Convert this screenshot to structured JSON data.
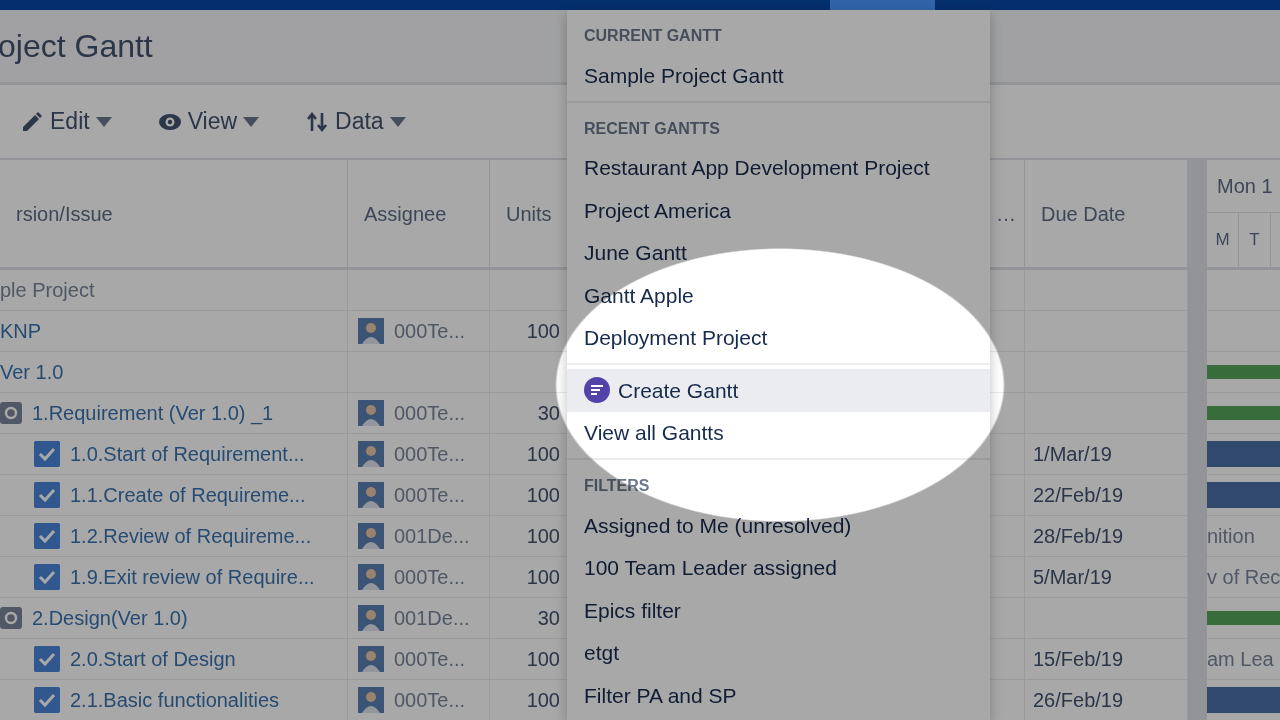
{
  "page_title": "oject Gantt",
  "toolbar": [
    {
      "label": "Edit"
    },
    {
      "label": "View"
    },
    {
      "label": "Data"
    }
  ],
  "table": {
    "columns": [
      "rsion/Issue",
      "Assignee",
      "Units",
      "…",
      "Due Date"
    ],
    "timeline": {
      "week": "Mon 1",
      "days": [
        "M",
        "T"
      ]
    },
    "rows": [
      {
        "kind": "project",
        "title": "ple Project",
        "units": "",
        "due": ""
      },
      {
        "kind": "version",
        "title": "KNP",
        "assignee": "000Te...",
        "units": "100",
        "due": ""
      },
      {
        "kind": "version",
        "title": "Ver 1.0",
        "units": "",
        "due": "",
        "bar": {
          "kind": "summary"
        }
      },
      {
        "kind": "group",
        "title": "1.Requirement (Ver 1.0) _1",
        "assignee": "000Te...",
        "units": "30",
        "due": "",
        "bar": {
          "kind": "summary"
        },
        "children": [
          {
            "kind": "task",
            "checked": true,
            "title": "1.0.Start of Requirement...",
            "assignee": "000Te...",
            "units": "100",
            "due": "1/Mar/19",
            "bar": {
              "kind": "task"
            }
          },
          {
            "kind": "task",
            "checked": true,
            "title": "1.1.Create of Requireme...",
            "assignee": "000Te...",
            "units": "100",
            "due": "22/Feb/19",
            "bar": {
              "kind": "task"
            }
          },
          {
            "kind": "task",
            "checked": true,
            "title": "1.2.Review of Requireme...",
            "assignee": "001De...",
            "units": "100",
            "due": "28/Feb/19",
            "bar": {
              "kind": "label",
              "text": "nition"
            }
          },
          {
            "kind": "task",
            "checked": true,
            "title": "1.9.Exit review of Require...",
            "assignee": "000Te...",
            "units": "100",
            "due": "5/Mar/19",
            "bar": {
              "kind": "label",
              "text": "v of Rec"
            }
          }
        ]
      },
      {
        "kind": "group",
        "title": "2.Design(Ver 1.0)",
        "assignee": "001De...",
        "units": "30",
        "due": "",
        "bar": {
          "kind": "summary"
        },
        "children": [
          {
            "kind": "task",
            "checked": true,
            "title": "2.0.Start of Design",
            "assignee": "000Te...",
            "units": "100",
            "due": "15/Feb/19",
            "bar": {
              "kind": "label",
              "text": "am Lea"
            }
          },
          {
            "kind": "task",
            "checked": true,
            "title": "2.1.Basic functionalities",
            "assignee": "000Te...",
            "units": "100",
            "due": "26/Feb/19",
            "bar": {
              "kind": "task"
            }
          }
        ]
      }
    ]
  },
  "dropdown": {
    "sections": [
      {
        "heading": "CURRENT GANTT",
        "items": [
          {
            "label": "Sample Project Gantt",
            "selected": false
          }
        ]
      },
      {
        "heading": "RECENT GANTTS",
        "items": [
          {
            "label": "Restaurant App Development Project",
            "selected": false
          },
          {
            "label": "Project America",
            "selected": false
          },
          {
            "label": "June Gantt",
            "selected": false
          },
          {
            "label": "Gantt Apple",
            "selected": false
          },
          {
            "label": "Deployment Project",
            "selected": false
          }
        ]
      },
      {
        "items": [
          {
            "label": "Create Gantt",
            "kind": "action",
            "selected": true
          },
          {
            "label": "View all Gantts",
            "selected": false
          }
        ]
      },
      {
        "heading": "FILTERS",
        "items": [
          {
            "label": "Assigned to Me (unresolved)",
            "selected": false
          },
          {
            "label": "100 Team Leader assigned",
            "selected": false
          },
          {
            "label": "Epics filter",
            "selected": false
          },
          {
            "label": "etgt",
            "selected": false
          },
          {
            "label": "Filter PA and SP",
            "selected": false
          }
        ]
      }
    ]
  }
}
